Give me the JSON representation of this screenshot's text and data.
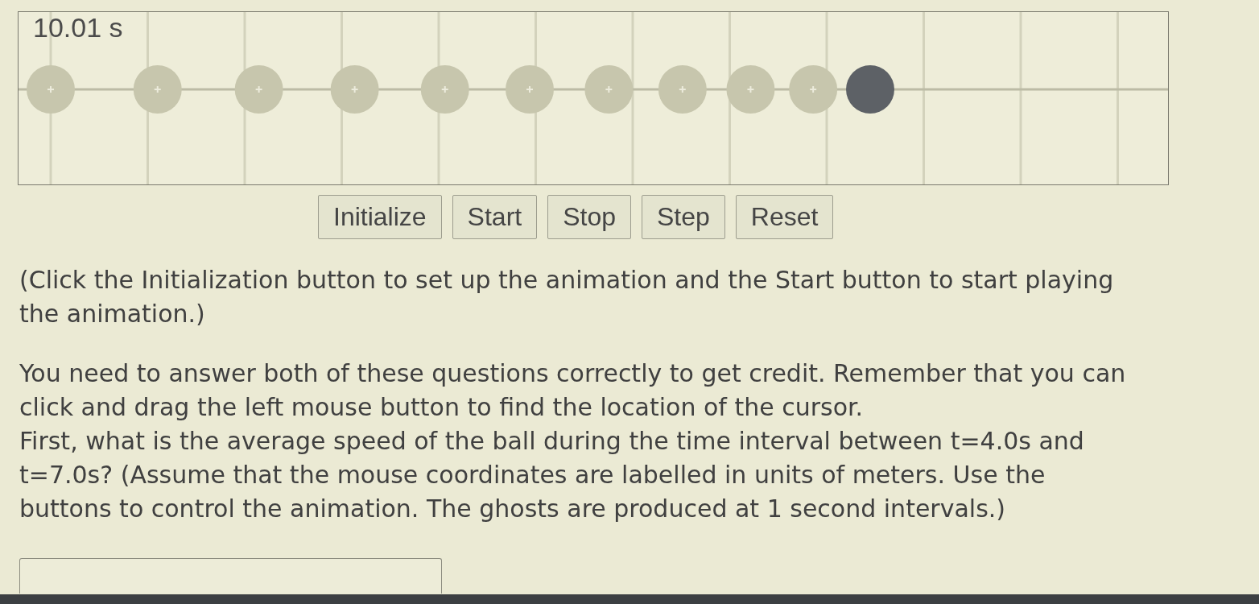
{
  "timer": "10.01 s",
  "animation": {
    "balls": [
      {
        "kind": "ghost"
      },
      {
        "kind": "ghost"
      },
      {
        "kind": "ghost"
      },
      {
        "kind": "ghost"
      },
      {
        "kind": "ghost"
      },
      {
        "kind": "ghost"
      },
      {
        "kind": "ghost"
      },
      {
        "kind": "ghost"
      },
      {
        "kind": "ghost"
      },
      {
        "kind": "ghost"
      },
      {
        "kind": "ball"
      }
    ]
  },
  "buttons": [
    "Initialize",
    "Start",
    "Stop",
    "Step",
    "Reset"
  ],
  "note": "(Click the Initialization button to set up the animation and the Start button to start playing the animation.)",
  "instructions": "You need to answer both of these questions correctly to get credit. Remember that you can click and drag the left mouse button to find the location of the cursor.",
  "question": "First, what is the average speed of the ball during the time interval between t=4.0s and t=7.0s? (Assume that the mouse coordinates are labelled in units of meters. Use the buttons to control the animation. The ghosts are produced at 1 second intervals.)"
}
